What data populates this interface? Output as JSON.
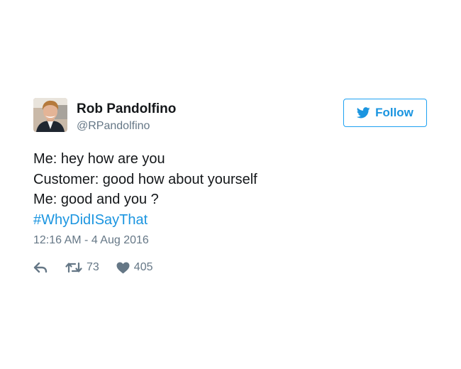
{
  "author": {
    "name": "Rob Pandolfino",
    "handle": "@RPandolfino",
    "avatar_icon": "user-avatar-photo"
  },
  "follow_button": {
    "label": "Follow",
    "icon": "twitter-bird-icon",
    "color": "#1b95e0"
  },
  "tweet": {
    "lines": [
      "Me: hey how are you",
      "Customer: good how about yourself",
      "Me: good and you ?"
    ],
    "hashtag": "#WhyDidISayThat",
    "timestamp": "12:16 AM - 4 Aug 2016"
  },
  "actions": {
    "reply_icon": "reply-icon",
    "retweet_icon": "retweet-icon",
    "retweet_count": "73",
    "like_icon": "heart-icon",
    "like_count": "405"
  },
  "colors": {
    "text": "#14171a",
    "secondary": "#657786",
    "link": "#1b95e0"
  }
}
